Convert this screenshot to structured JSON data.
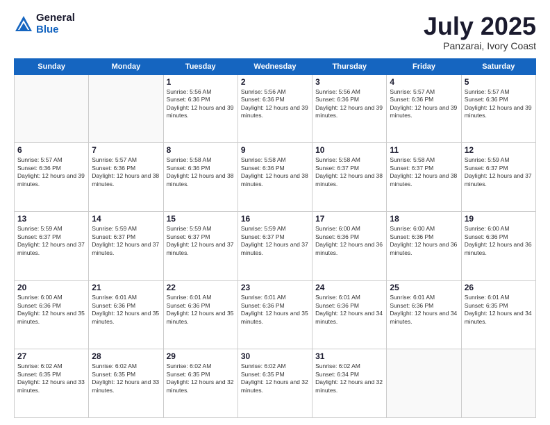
{
  "header": {
    "logo_general": "General",
    "logo_blue": "Blue",
    "month_title": "July 2025",
    "subtitle": "Panzarai, Ivory Coast"
  },
  "days_of_week": [
    "Sunday",
    "Monday",
    "Tuesday",
    "Wednesday",
    "Thursday",
    "Friday",
    "Saturday"
  ],
  "weeks": [
    [
      {
        "day": "",
        "sunrise": "",
        "sunset": "",
        "daylight": ""
      },
      {
        "day": "",
        "sunrise": "",
        "sunset": "",
        "daylight": ""
      },
      {
        "day": "1",
        "sunrise": "Sunrise: 5:56 AM",
        "sunset": "Sunset: 6:36 PM",
        "daylight": "Daylight: 12 hours and 39 minutes."
      },
      {
        "day": "2",
        "sunrise": "Sunrise: 5:56 AM",
        "sunset": "Sunset: 6:36 PM",
        "daylight": "Daylight: 12 hours and 39 minutes."
      },
      {
        "day": "3",
        "sunrise": "Sunrise: 5:56 AM",
        "sunset": "Sunset: 6:36 PM",
        "daylight": "Daylight: 12 hours and 39 minutes."
      },
      {
        "day": "4",
        "sunrise": "Sunrise: 5:57 AM",
        "sunset": "Sunset: 6:36 PM",
        "daylight": "Daylight: 12 hours and 39 minutes."
      },
      {
        "day": "5",
        "sunrise": "Sunrise: 5:57 AM",
        "sunset": "Sunset: 6:36 PM",
        "daylight": "Daylight: 12 hours and 39 minutes."
      }
    ],
    [
      {
        "day": "6",
        "sunrise": "Sunrise: 5:57 AM",
        "sunset": "Sunset: 6:36 PM",
        "daylight": "Daylight: 12 hours and 39 minutes."
      },
      {
        "day": "7",
        "sunrise": "Sunrise: 5:57 AM",
        "sunset": "Sunset: 6:36 PM",
        "daylight": "Daylight: 12 hours and 38 minutes."
      },
      {
        "day": "8",
        "sunrise": "Sunrise: 5:58 AM",
        "sunset": "Sunset: 6:36 PM",
        "daylight": "Daylight: 12 hours and 38 minutes."
      },
      {
        "day": "9",
        "sunrise": "Sunrise: 5:58 AM",
        "sunset": "Sunset: 6:36 PM",
        "daylight": "Daylight: 12 hours and 38 minutes."
      },
      {
        "day": "10",
        "sunrise": "Sunrise: 5:58 AM",
        "sunset": "Sunset: 6:37 PM",
        "daylight": "Daylight: 12 hours and 38 minutes."
      },
      {
        "day": "11",
        "sunrise": "Sunrise: 5:58 AM",
        "sunset": "Sunset: 6:37 PM",
        "daylight": "Daylight: 12 hours and 38 minutes."
      },
      {
        "day": "12",
        "sunrise": "Sunrise: 5:59 AM",
        "sunset": "Sunset: 6:37 PM",
        "daylight": "Daylight: 12 hours and 37 minutes."
      }
    ],
    [
      {
        "day": "13",
        "sunrise": "Sunrise: 5:59 AM",
        "sunset": "Sunset: 6:37 PM",
        "daylight": "Daylight: 12 hours and 37 minutes."
      },
      {
        "day": "14",
        "sunrise": "Sunrise: 5:59 AM",
        "sunset": "Sunset: 6:37 PM",
        "daylight": "Daylight: 12 hours and 37 minutes."
      },
      {
        "day": "15",
        "sunrise": "Sunrise: 5:59 AM",
        "sunset": "Sunset: 6:37 PM",
        "daylight": "Daylight: 12 hours and 37 minutes."
      },
      {
        "day": "16",
        "sunrise": "Sunrise: 5:59 AM",
        "sunset": "Sunset: 6:37 PM",
        "daylight": "Daylight: 12 hours and 37 minutes."
      },
      {
        "day": "17",
        "sunrise": "Sunrise: 6:00 AM",
        "sunset": "Sunset: 6:36 PM",
        "daylight": "Daylight: 12 hours and 36 minutes."
      },
      {
        "day": "18",
        "sunrise": "Sunrise: 6:00 AM",
        "sunset": "Sunset: 6:36 PM",
        "daylight": "Daylight: 12 hours and 36 minutes."
      },
      {
        "day": "19",
        "sunrise": "Sunrise: 6:00 AM",
        "sunset": "Sunset: 6:36 PM",
        "daylight": "Daylight: 12 hours and 36 minutes."
      }
    ],
    [
      {
        "day": "20",
        "sunrise": "Sunrise: 6:00 AM",
        "sunset": "Sunset: 6:36 PM",
        "daylight": "Daylight: 12 hours and 35 minutes."
      },
      {
        "day": "21",
        "sunrise": "Sunrise: 6:01 AM",
        "sunset": "Sunset: 6:36 PM",
        "daylight": "Daylight: 12 hours and 35 minutes."
      },
      {
        "day": "22",
        "sunrise": "Sunrise: 6:01 AM",
        "sunset": "Sunset: 6:36 PM",
        "daylight": "Daylight: 12 hours and 35 minutes."
      },
      {
        "day": "23",
        "sunrise": "Sunrise: 6:01 AM",
        "sunset": "Sunset: 6:36 PM",
        "daylight": "Daylight: 12 hours and 35 minutes."
      },
      {
        "day": "24",
        "sunrise": "Sunrise: 6:01 AM",
        "sunset": "Sunset: 6:36 PM",
        "daylight": "Daylight: 12 hours and 34 minutes."
      },
      {
        "day": "25",
        "sunrise": "Sunrise: 6:01 AM",
        "sunset": "Sunset: 6:36 PM",
        "daylight": "Daylight: 12 hours and 34 minutes."
      },
      {
        "day": "26",
        "sunrise": "Sunrise: 6:01 AM",
        "sunset": "Sunset: 6:35 PM",
        "daylight": "Daylight: 12 hours and 34 minutes."
      }
    ],
    [
      {
        "day": "27",
        "sunrise": "Sunrise: 6:02 AM",
        "sunset": "Sunset: 6:35 PM",
        "daylight": "Daylight: 12 hours and 33 minutes."
      },
      {
        "day": "28",
        "sunrise": "Sunrise: 6:02 AM",
        "sunset": "Sunset: 6:35 PM",
        "daylight": "Daylight: 12 hours and 33 minutes."
      },
      {
        "day": "29",
        "sunrise": "Sunrise: 6:02 AM",
        "sunset": "Sunset: 6:35 PM",
        "daylight": "Daylight: 12 hours and 32 minutes."
      },
      {
        "day": "30",
        "sunrise": "Sunrise: 6:02 AM",
        "sunset": "Sunset: 6:35 PM",
        "daylight": "Daylight: 12 hours and 32 minutes."
      },
      {
        "day": "31",
        "sunrise": "Sunrise: 6:02 AM",
        "sunset": "Sunset: 6:34 PM",
        "daylight": "Daylight: 12 hours and 32 minutes."
      },
      {
        "day": "",
        "sunrise": "",
        "sunset": "",
        "daylight": ""
      },
      {
        "day": "",
        "sunrise": "",
        "sunset": "",
        "daylight": ""
      }
    ]
  ]
}
